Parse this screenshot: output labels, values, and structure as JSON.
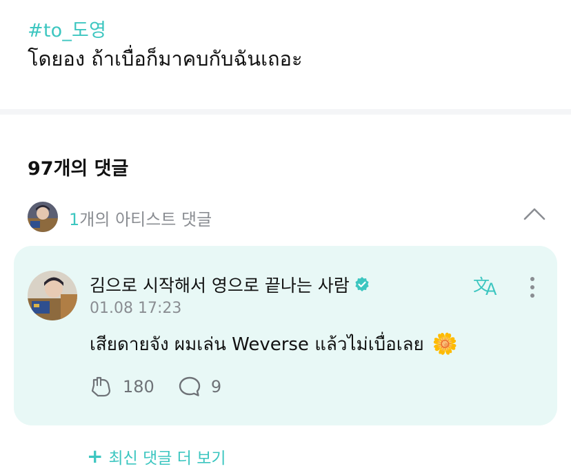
{
  "post": {
    "hashtag": "#to_도영",
    "text": "โดยอง ถ้าเบื่อก็มาคบกับฉันเถอะ"
  },
  "comments": {
    "title": "97개의 댓글",
    "artist_count": "1",
    "artist_label": "개의 아티스트 댓글"
  },
  "artist_comment": {
    "author": "김으로 시작해서 영으로 끝나는 사람",
    "date": "01.08 17:23",
    "text": "เสียดายจัง ผมเล่น Weverse แล้วไม่เบื่อเลย",
    "emoji": "🌼",
    "likes": "180",
    "replies": "9"
  },
  "more_comments_label": "최신 댓글 더 보기",
  "colors": {
    "accent": "#3cc6c0",
    "card_bg": "#e8f8f6",
    "muted": "#8a8d92"
  },
  "icons": [
    "chevron-up-icon",
    "verified-badge-icon",
    "translate-icon",
    "more-vertical-icon",
    "like-icon",
    "comment-icon",
    "plus-icon",
    "sunflower-emoji"
  ]
}
